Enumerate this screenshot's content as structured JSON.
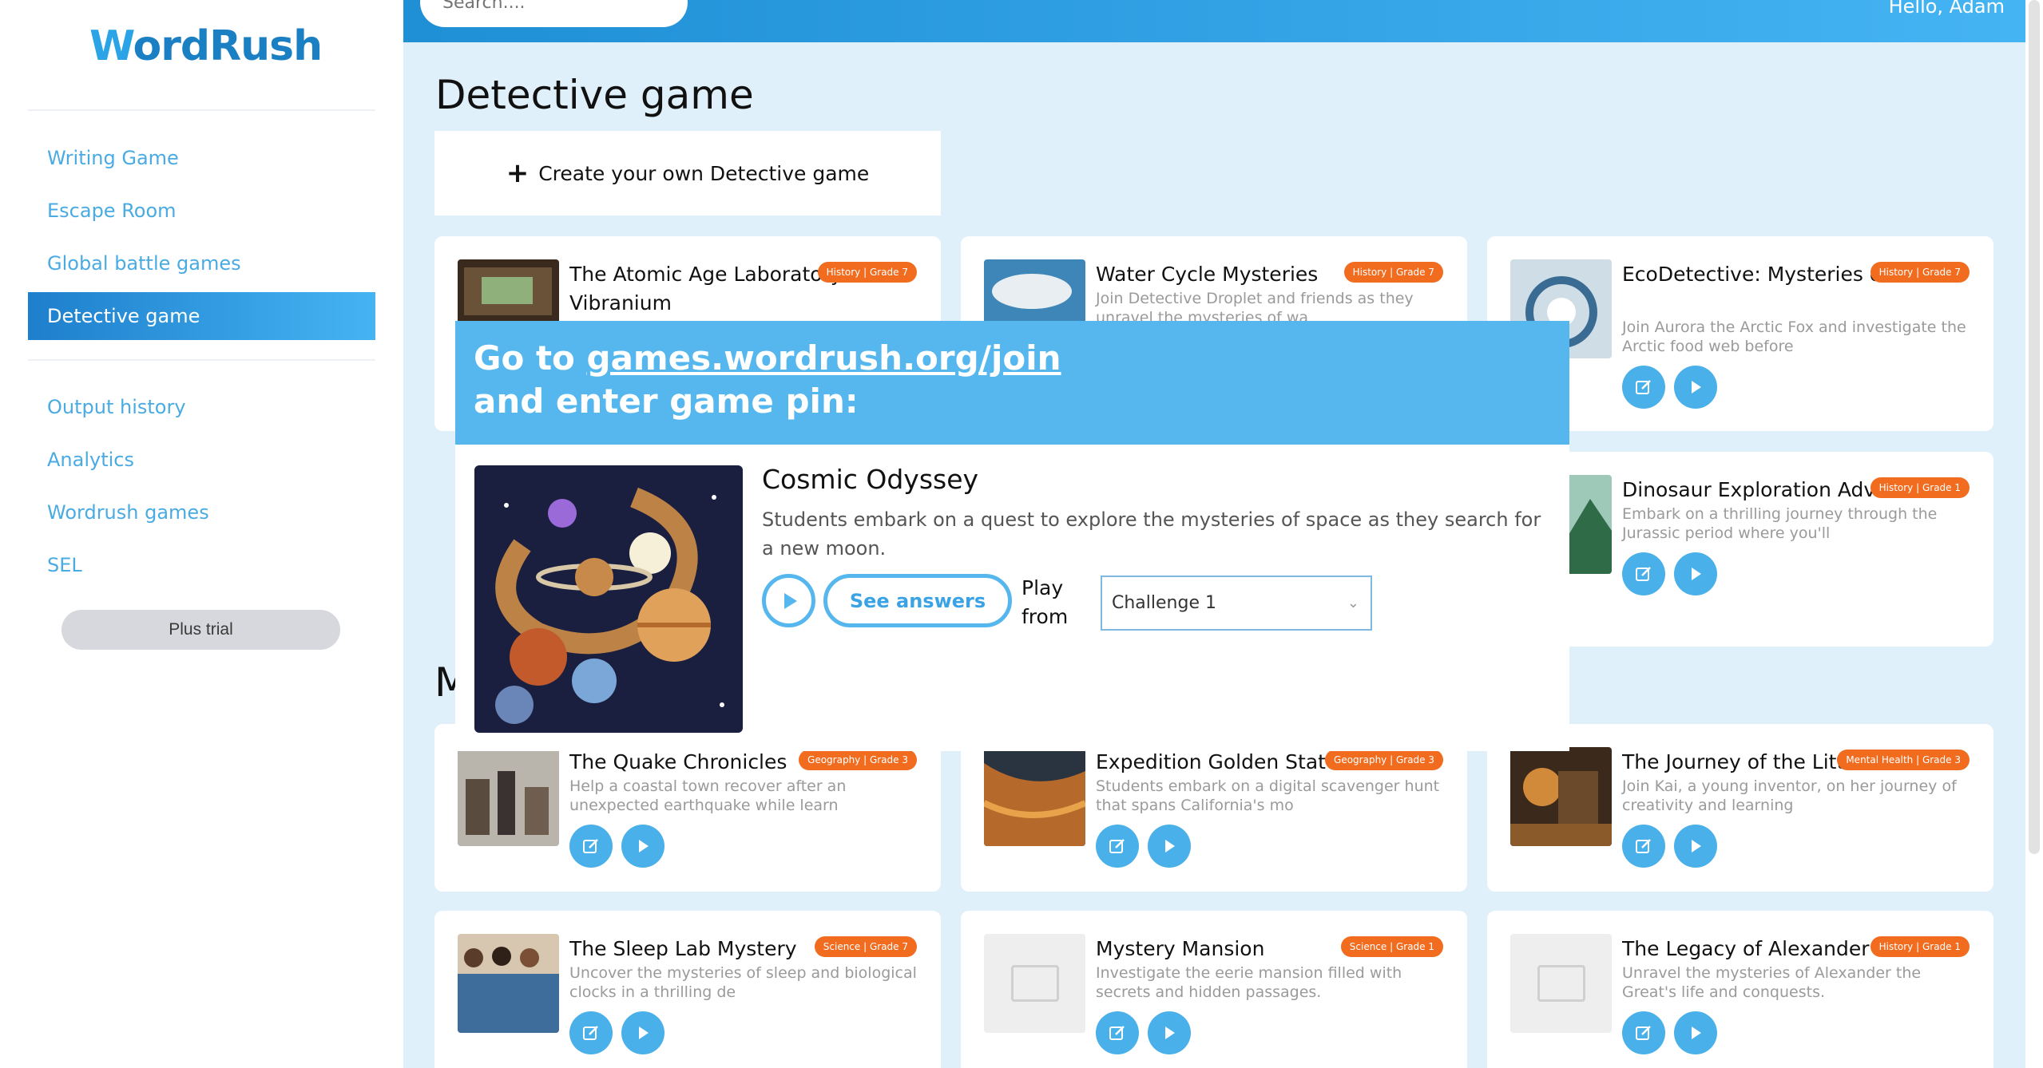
{
  "sidebar": {
    "logo": {
      "prefix": "W",
      "rest": "ordRush"
    },
    "nav_top": [
      {
        "label": "Writing Game"
      },
      {
        "label": "Escape Room"
      },
      {
        "label": "Global battle games"
      },
      {
        "label": "Detective game",
        "active": true
      }
    ],
    "nav_bottom": [
      {
        "label": "Output history"
      },
      {
        "label": "Analytics"
      },
      {
        "label": "Wordrush games"
      },
      {
        "label": "SEL"
      }
    ],
    "plus_trial": "Plus trial"
  },
  "header": {
    "search_placeholder": "Search....",
    "greeting": "Hello, Adam"
  },
  "page": {
    "title": "Detective game",
    "create_label": "Create your own Detective game",
    "section_letter": "M"
  },
  "cards": [
    {
      "title": "The Atomic Age Laboratory: Vibranium",
      "badge": "History | Grade 7",
      "desc": ""
    },
    {
      "title": "Water Cycle Mysteries",
      "badge": "History | Grade 7",
      "desc": "Join Detective Droplet and friends as they unravel the mysteries of wa"
    },
    {
      "title": "EcoDetective: Mysteries of Web",
      "badge": "History | Grade 7",
      "desc": "Join Aurora the Arctic Fox and investigate the Arctic food web before"
    },
    {
      "title": "Dinosaur Exploration Adve",
      "badge": "History | Grade 1",
      "desc": "Embark on a thrilling journey through the Jurassic period where you'll"
    },
    {
      "title": "The Quake Chronicles",
      "badge": "Geography | Grade 3",
      "desc": "Help a coastal town recover after an unexpected earthquake while learn"
    },
    {
      "title": "Expedition Golden State",
      "badge": "Geography | Grade 3",
      "desc": "Students embark on a digital scavenger hunt that spans California's mo"
    },
    {
      "title": "The Journey of the Littl",
      "badge": "Mental Health | Grade 3",
      "desc": "Join Kai, a young inventor, on her journey of creativity and learning"
    },
    {
      "title": "The Sleep Lab Mystery",
      "badge": "Science | Grade 7",
      "desc": "Uncover the mysteries of sleep and biological clocks in a thrilling de"
    },
    {
      "title": "Mystery Mansion",
      "badge": "Science | Grade 1",
      "desc": "Investigate the eerie mansion filled with secrets and hidden passages."
    },
    {
      "title": "The Legacy of Alexander",
      "badge": "History | Grade 1",
      "desc": "Unravel the mysteries of Alexander the Great's life and conquests."
    }
  ],
  "modal": {
    "line1_prefix": "Go to ",
    "link": "games.wordrush.org/join",
    "line2": "and enter game pin:",
    "title": "Cosmic Odyssey",
    "desc": "Students embark on a quest to explore the mysteries of space as they search for a new moon.",
    "see_answers": "See answers",
    "play_from": "Play from",
    "select_value": "Challenge 1"
  },
  "colors": {
    "accent": "#45b4f3",
    "accent_dark": "#1e7fcc",
    "badge": "#f16c1f",
    "main_bg": "#dff0fb"
  }
}
